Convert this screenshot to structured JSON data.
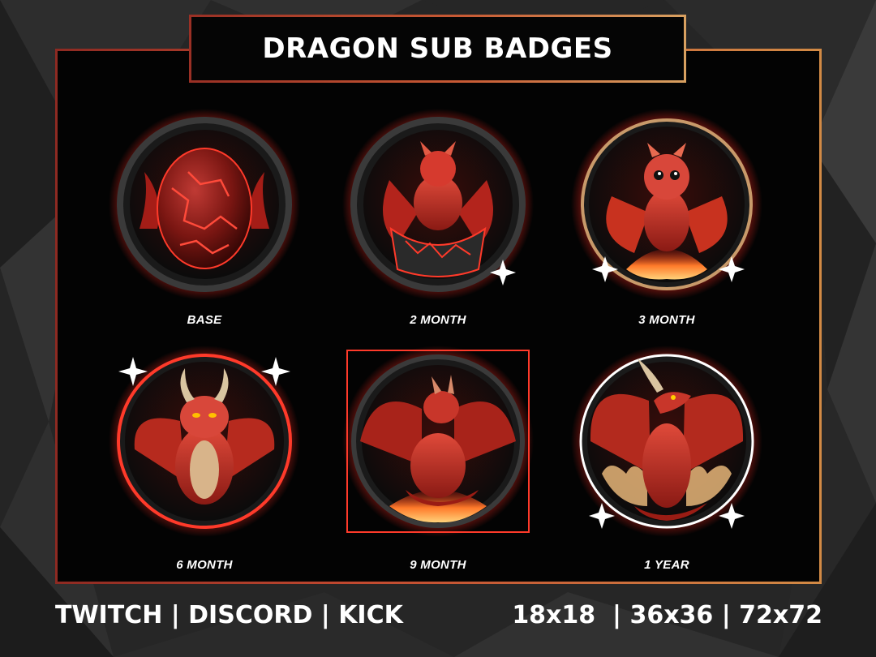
{
  "title": "DRAGON SUB BADGES",
  "badges": [
    {
      "label": "BASE",
      "icon": "dragon-egg-icon"
    },
    {
      "label": "2 MONTH",
      "icon": "hatching-dragon-icon"
    },
    {
      "label": "3 MONTH",
      "icon": "baby-dragon-icon"
    },
    {
      "label": "6 MONTH",
      "icon": "young-dragon-icon"
    },
    {
      "label": "9 MONTH",
      "icon": "winged-dragon-icon"
    },
    {
      "label": "1 YEAR",
      "icon": "adult-dragon-icon"
    }
  ],
  "footer": {
    "platforms": "TWITCH | DISCORD | KICK",
    "sizes": "18x18  | 36x36 | 72x72"
  },
  "colors": {
    "accent_red": "#e0201a",
    "glow": "#ff2a1f",
    "frame_gradient_start": "#8e2a22",
    "frame_gradient_end": "#d28a45",
    "background": "#262626"
  }
}
